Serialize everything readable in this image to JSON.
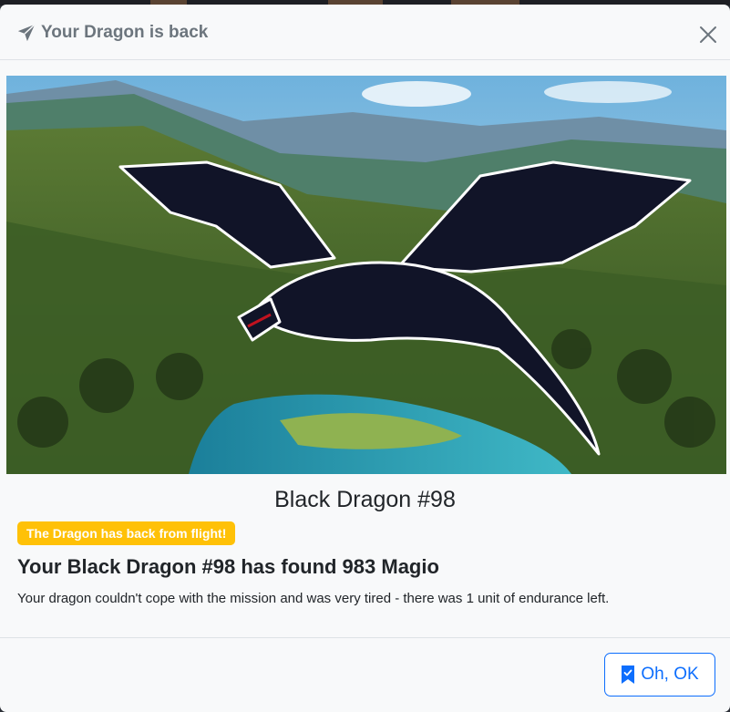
{
  "modal": {
    "title": "Your Dragon is back",
    "dragon_name": "Black Dragon #98",
    "badge": "The Dragon has back from flight!",
    "found_message": "Your Black Dragon #98 has found 983 Magio",
    "details": "Your dragon couldn't cope with the mission and was very tired - there was 1 unit of endurance left.",
    "ok_label": "Oh, OK"
  },
  "icons": {
    "header": "send-icon",
    "close": "close-icon",
    "ok": "bookmark-check-icon"
  },
  "colors": {
    "badge": "#ffc107",
    "primary": "#0d6efd",
    "title": "#6c757d",
    "text": "#212529"
  }
}
